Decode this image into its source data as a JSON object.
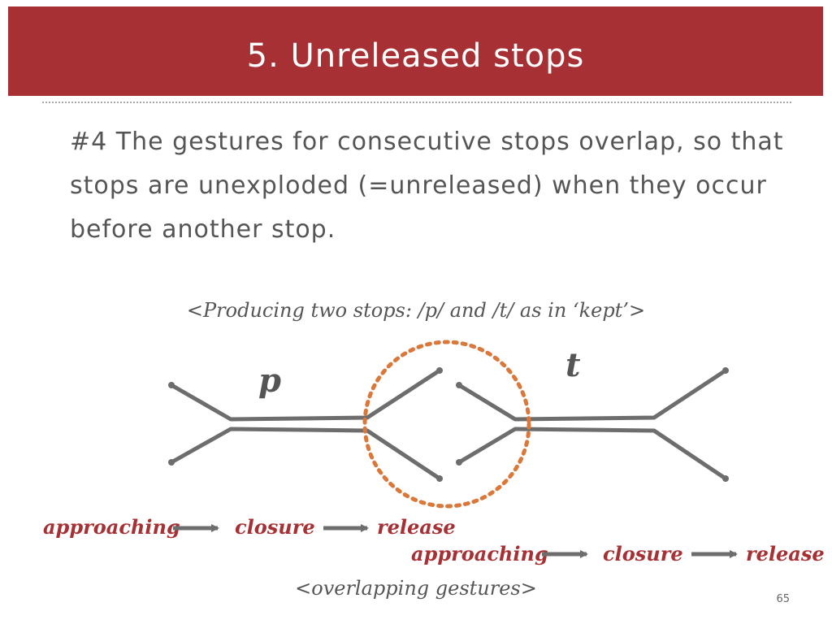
{
  "slide": {
    "title": "5. Unreleased stops",
    "body": "#4 The gestures for consecutive stops overlap, so that stops are unexploded (=unreleased) when they occur before another stop.",
    "caption_top": "<Producing two stops: /p/ and /t/ as in ‘kept’>",
    "caption_bottom": "<overlapping gestures>",
    "page_number": "65"
  },
  "diagram": {
    "letters": {
      "p": "p",
      "t": "t"
    },
    "row1": {
      "approaching": "approaching",
      "closure": "closure",
      "release": "release"
    },
    "row2": {
      "approaching": "approaching",
      "closure": "closure",
      "release": "release"
    }
  },
  "colors": {
    "header": "#a63033",
    "label": "#a63033",
    "line": "#6d6d6d",
    "circle": "#d9783a",
    "arrow": "#6d6d6d"
  }
}
